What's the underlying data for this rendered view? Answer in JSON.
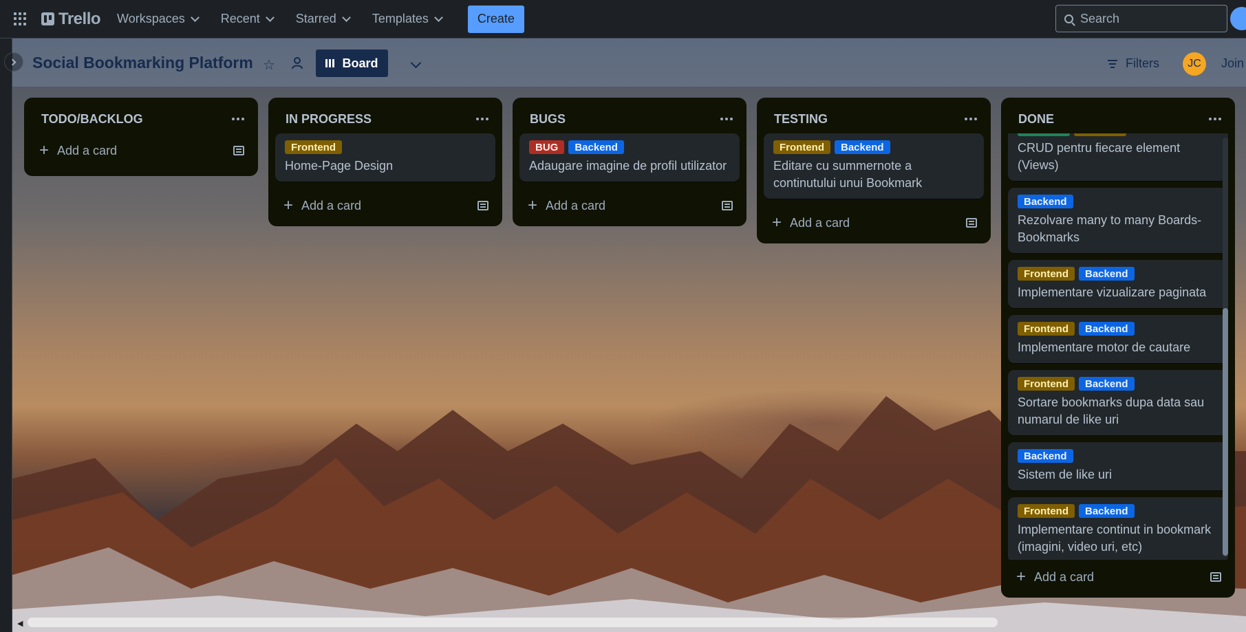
{
  "topnav": {
    "brand": "Trello",
    "items": [
      {
        "label": "Workspaces"
      },
      {
        "label": "Recent"
      },
      {
        "label": "Starred"
      },
      {
        "label": "Templates"
      }
    ],
    "create_label": "Create",
    "search_placeholder": "Search"
  },
  "board": {
    "title": "Social Bookmarking Platform",
    "view_label": "Board",
    "filters_label": "Filters",
    "avatar_initials": "JC",
    "join_label": "Join bo"
  },
  "lists": [
    {
      "title": "TODO/BACKLOG",
      "add_label": "Add a card",
      "cards": []
    },
    {
      "title": "IN PROGRESS",
      "add_label": "Add a card",
      "cards": [
        {
          "labels": [
            {
              "text": "Frontend",
              "kind": "frontend"
            }
          ],
          "title": "Home-Page Design"
        }
      ]
    },
    {
      "title": "BUGS",
      "add_label": "Add a card",
      "cards": [
        {
          "labels": [
            {
              "text": "BUG",
              "kind": "bug"
            },
            {
              "text": "Backend",
              "kind": "backend"
            }
          ],
          "title": "Adaugare imagine de profil utilizator"
        }
      ]
    },
    {
      "title": "TESTING",
      "add_label": "Add a card",
      "cards": [
        {
          "labels": [
            {
              "text": "Frontend",
              "kind": "frontend"
            },
            {
              "text": "Backend",
              "kind": "backend"
            }
          ],
          "title": "Editare cu summernote a continutului unui Bookmark"
        }
      ]
    },
    {
      "title": "DONE",
      "add_label": "Add a card",
      "cards": [
        {
          "labels": [],
          "title": "CRUD pentru fiecare element (Views)"
        },
        {
          "labels": [
            {
              "text": "Backend",
              "kind": "backend"
            }
          ],
          "title": "Rezolvare many to many Boards-Bookmarks"
        },
        {
          "labels": [
            {
              "text": "Frontend",
              "kind": "frontend"
            },
            {
              "text": "Backend",
              "kind": "backend"
            }
          ],
          "title": "Implementare vizualizare paginata"
        },
        {
          "labels": [
            {
              "text": "Frontend",
              "kind": "frontend"
            },
            {
              "text": "Backend",
              "kind": "backend"
            }
          ],
          "title": "Implementare motor de cautare"
        },
        {
          "labels": [
            {
              "text": "Frontend",
              "kind": "frontend"
            },
            {
              "text": "Backend",
              "kind": "backend"
            }
          ],
          "title": "Sortare bookmarks dupa data sau numarul de like uri"
        },
        {
          "labels": [
            {
              "text": "Backend",
              "kind": "backend"
            }
          ],
          "title": "Sistem de like uri"
        },
        {
          "labels": [
            {
              "text": "Frontend",
              "kind": "frontend"
            },
            {
              "text": "Backend",
              "kind": "backend"
            }
          ],
          "title": "Implementare continut in bookmark (imagini, video uri, etc)"
        }
      ]
    }
  ],
  "colors": {
    "label_frontend": "#7f5f01",
    "label_backend": "#0c66e4",
    "label_bug": "#ae2e24",
    "create_button": "#579dff",
    "list_bg": "#101204",
    "card_bg": "#22272b"
  },
  "icons": [
    "apps-grid-icon",
    "trello-logo-icon",
    "chevron-down-icon",
    "search-icon",
    "star-icon",
    "people-icon",
    "board-view-icon",
    "filter-icon",
    "dots-menu-icon",
    "plus-icon",
    "template-icon"
  ]
}
